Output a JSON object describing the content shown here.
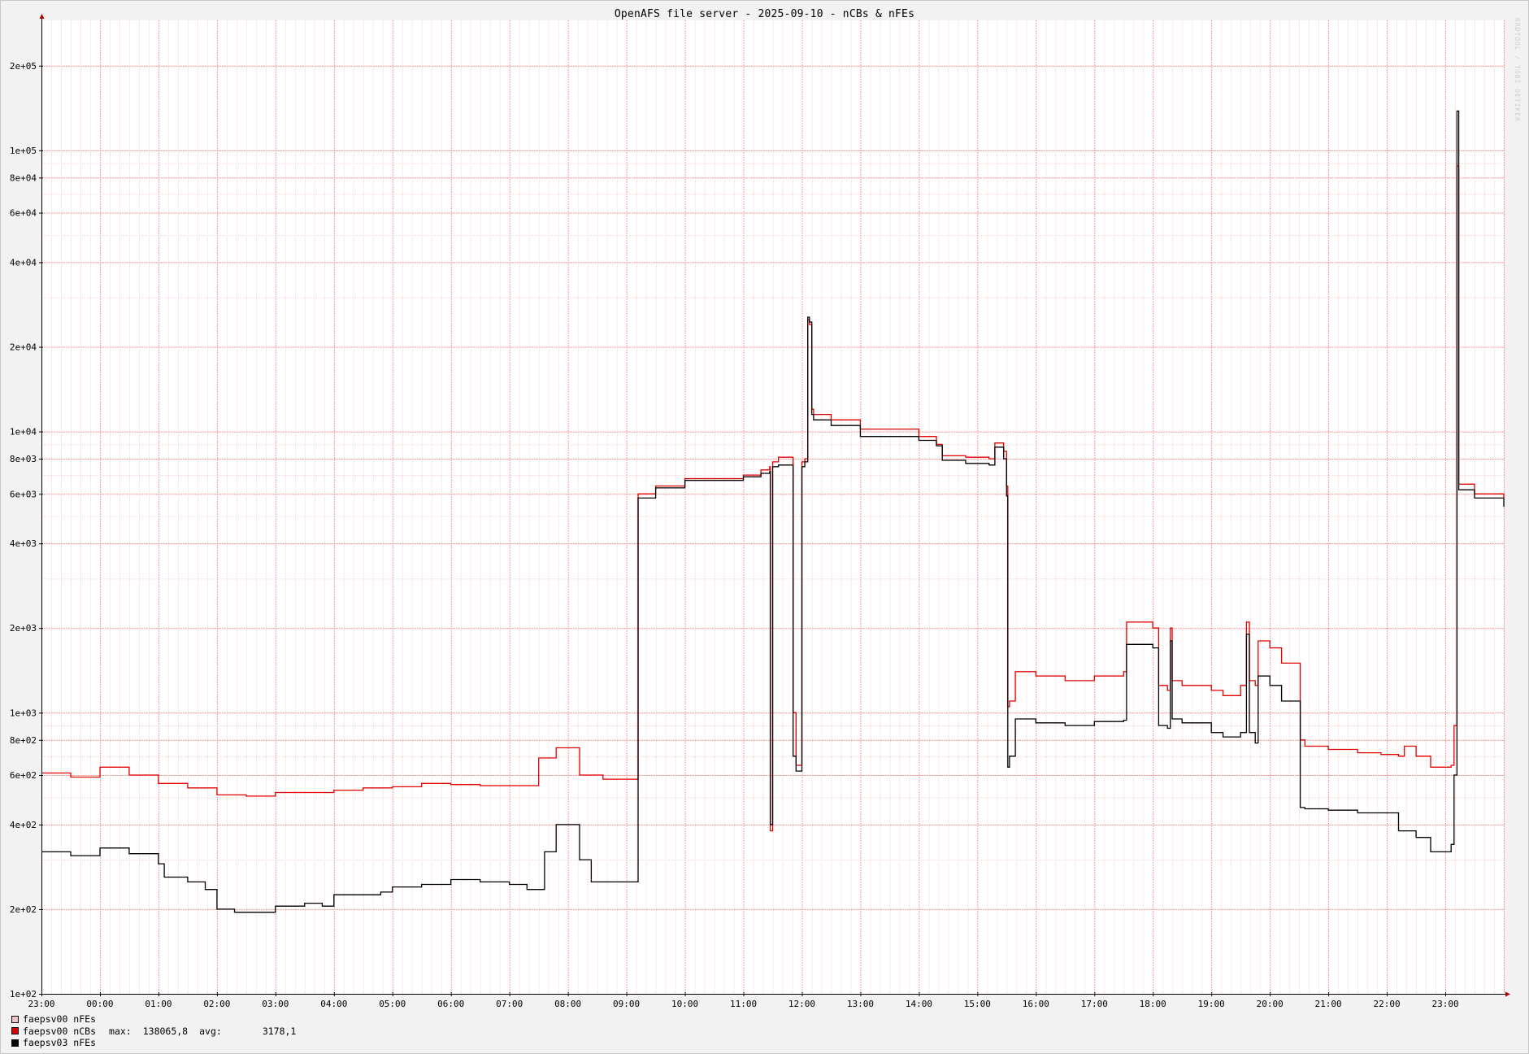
{
  "chart_data": {
    "type": "line",
    "title": "OpenAFS file server - 2025-09-10 - nCBs & nFEs",
    "watermark": "RRDTOOL / TOBI OETIKER",
    "y_scale": "log",
    "ylim": [
      100,
      290000
    ],
    "y_ticks": [
      {
        "value": 200000,
        "label": "2e+05"
      },
      {
        "value": 100000,
        "label": "1e+05"
      },
      {
        "value": 80000,
        "label": "8e+04"
      },
      {
        "value": 60000,
        "label": "6e+04"
      },
      {
        "value": 40000,
        "label": "4e+04"
      },
      {
        "value": 20000,
        "label": "2e+04"
      },
      {
        "value": 10000,
        "label": "1e+04"
      },
      {
        "value": 8000,
        "label": "8e+03"
      },
      {
        "value": 6000,
        "label": "6e+03"
      },
      {
        "value": 4000,
        "label": "4e+03"
      },
      {
        "value": 2000,
        "label": "2e+03"
      },
      {
        "value": 1000,
        "label": "1e+03"
      },
      {
        "value": 800,
        "label": "8e+02"
      },
      {
        "value": 600,
        "label": "6e+02"
      },
      {
        "value": 400,
        "label": "4e+02"
      },
      {
        "value": 200,
        "label": "2e+02"
      },
      {
        "value": 100,
        "label": "1e+02"
      }
    ],
    "x_unit": "hours since 23:00 (previous day)",
    "xlim": [
      0,
      25
    ],
    "x_ticks": [
      "23:00",
      "00:00",
      "01:00",
      "02:00",
      "03:00",
      "04:00",
      "05:00",
      "06:00",
      "07:00",
      "08:00",
      "09:00",
      "10:00",
      "11:00",
      "12:00",
      "13:00",
      "14:00",
      "15:00",
      "16:00",
      "17:00",
      "18:00",
      "19:00",
      "20:00",
      "21:00",
      "22:00",
      "23:00"
    ],
    "grid": true,
    "legend_position": "bottom-left",
    "series": [
      {
        "name": "faepsv00 nFEs",
        "color": "#f2c4c4",
        "values": []
      },
      {
        "name": "faepsv00 nCBs",
        "color": "#e00000",
        "stats": {
          "max_label": "max:",
          "max": "138065,8",
          "avg_label": "avg:",
          "avg": "3178,1"
        },
        "points": [
          [
            0.0,
            610
          ],
          [
            0.5,
            590
          ],
          [
            1.0,
            640
          ],
          [
            1.5,
            600
          ],
          [
            2.0,
            560
          ],
          [
            2.5,
            540
          ],
          [
            3.0,
            510
          ],
          [
            3.5,
            505
          ],
          [
            4.0,
            520
          ],
          [
            4.5,
            520
          ],
          [
            5.0,
            530
          ],
          [
            5.5,
            540
          ],
          [
            6.0,
            545
          ],
          [
            6.5,
            560
          ],
          [
            7.0,
            555
          ],
          [
            7.5,
            550
          ],
          [
            8.0,
            550
          ],
          [
            8.5,
            690
          ],
          [
            8.8,
            750
          ],
          [
            9.2,
            600
          ],
          [
            9.6,
            580
          ],
          [
            10.2,
            6000
          ],
          [
            10.5,
            6400
          ],
          [
            11.0,
            6800
          ],
          [
            12.0,
            7000
          ],
          [
            12.3,
            7300
          ],
          [
            12.45,
            7500
          ],
          [
            12.46,
            380
          ],
          [
            12.5,
            7800
          ],
          [
            12.6,
            8100
          ],
          [
            12.8,
            8100
          ],
          [
            12.85,
            1000
          ],
          [
            12.9,
            650
          ],
          [
            13.0,
            7800
          ],
          [
            13.05,
            8000
          ],
          [
            13.1,
            25000
          ],
          [
            13.13,
            24000
          ],
          [
            13.17,
            12000
          ],
          [
            13.2,
            11500
          ],
          [
            13.5,
            11000
          ],
          [
            14.0,
            10200
          ],
          [
            15.0,
            9600
          ],
          [
            15.3,
            9000
          ],
          [
            15.4,
            8200
          ],
          [
            15.8,
            8100
          ],
          [
            16.2,
            8000
          ],
          [
            16.3,
            9100
          ],
          [
            16.45,
            8500
          ],
          [
            16.5,
            6400
          ],
          [
            16.52,
            1050
          ],
          [
            16.55,
            1100
          ],
          [
            16.65,
            1400
          ],
          [
            17.0,
            1350
          ],
          [
            17.5,
            1300
          ],
          [
            18.0,
            1350
          ],
          [
            18.5,
            1400
          ],
          [
            18.55,
            2100
          ],
          [
            19.0,
            2000
          ],
          [
            19.1,
            1250
          ],
          [
            19.25,
            1200
          ],
          [
            19.3,
            2000
          ],
          [
            19.33,
            1300
          ],
          [
            19.5,
            1250
          ],
          [
            20.0,
            1200
          ],
          [
            20.2,
            1150
          ],
          [
            20.5,
            1250
          ],
          [
            20.6,
            2100
          ],
          [
            20.65,
            1300
          ],
          [
            20.75,
            1250
          ],
          [
            20.8,
            1800
          ],
          [
            21.0,
            1700
          ],
          [
            21.2,
            1500
          ],
          [
            21.52,
            800
          ],
          [
            21.6,
            760
          ],
          [
            22.0,
            740
          ],
          [
            22.5,
            720
          ],
          [
            22.9,
            710
          ],
          [
            23.2,
            700
          ],
          [
            23.3,
            760
          ],
          [
            23.5,
            700
          ],
          [
            23.75,
            640
          ],
          [
            24.1,
            650
          ],
          [
            24.15,
            900
          ],
          [
            24.2,
            88000
          ],
          [
            24.23,
            6500
          ],
          [
            24.5,
            6000
          ],
          [
            25.0,
            5800
          ]
        ]
      },
      {
        "name": "faepsv03 nFEs",
        "color": "#000000",
        "points": [
          [
            0.0,
            320
          ],
          [
            0.5,
            310
          ],
          [
            1.0,
            330
          ],
          [
            1.5,
            315
          ],
          [
            2.0,
            290
          ],
          [
            2.1,
            260
          ],
          [
            2.5,
            250
          ],
          [
            2.8,
            235
          ],
          [
            3.0,
            200
          ],
          [
            3.3,
            195
          ],
          [
            3.6,
            195
          ],
          [
            4.0,
            205
          ],
          [
            4.5,
            210
          ],
          [
            4.8,
            205
          ],
          [
            5.0,
            225
          ],
          [
            5.5,
            225
          ],
          [
            5.8,
            230
          ],
          [
            6.0,
            240
          ],
          [
            6.5,
            245
          ],
          [
            7.0,
            255
          ],
          [
            7.5,
            250
          ],
          [
            8.0,
            245
          ],
          [
            8.3,
            235
          ],
          [
            8.6,
            320
          ],
          [
            8.8,
            400
          ],
          [
            9.2,
            300
          ],
          [
            9.4,
            250
          ],
          [
            9.6,
            250
          ],
          [
            10.2,
            5800
          ],
          [
            10.5,
            6300
          ],
          [
            11.0,
            6700
          ],
          [
            12.0,
            6900
          ],
          [
            12.3,
            7100
          ],
          [
            12.45,
            7200
          ],
          [
            12.46,
            400
          ],
          [
            12.5,
            7500
          ],
          [
            12.6,
            7600
          ],
          [
            12.8,
            7600
          ],
          [
            12.85,
            700
          ],
          [
            12.9,
            620
          ],
          [
            13.0,
            7500
          ],
          [
            13.05,
            7800
          ],
          [
            13.1,
            25500
          ],
          [
            13.13,
            24500
          ],
          [
            13.17,
            11500
          ],
          [
            13.2,
            11000
          ],
          [
            13.5,
            10500
          ],
          [
            14.0,
            9600
          ],
          [
            15.0,
            9300
          ],
          [
            15.3,
            8900
          ],
          [
            15.4,
            7900
          ],
          [
            15.8,
            7700
          ],
          [
            16.2,
            7600
          ],
          [
            16.3,
            8800
          ],
          [
            16.45,
            8000
          ],
          [
            16.5,
            5900
          ],
          [
            16.52,
            640
          ],
          [
            16.55,
            700
          ],
          [
            16.65,
            950
          ],
          [
            17.0,
            920
          ],
          [
            17.5,
            900
          ],
          [
            18.0,
            930
          ],
          [
            18.5,
            940
          ],
          [
            18.55,
            1750
          ],
          [
            19.0,
            1700
          ],
          [
            19.1,
            900
          ],
          [
            19.25,
            880
          ],
          [
            19.3,
            1800
          ],
          [
            19.33,
            950
          ],
          [
            19.5,
            920
          ],
          [
            20.0,
            850
          ],
          [
            20.2,
            820
          ],
          [
            20.5,
            850
          ],
          [
            20.6,
            1900
          ],
          [
            20.65,
            850
          ],
          [
            20.75,
            780
          ],
          [
            20.8,
            1350
          ],
          [
            21.0,
            1250
          ],
          [
            21.2,
            1100
          ],
          [
            21.52,
            460
          ],
          [
            21.6,
            455
          ],
          [
            22.0,
            450
          ],
          [
            22.5,
            440
          ],
          [
            22.9,
            440
          ],
          [
            23.2,
            380
          ],
          [
            23.5,
            360
          ],
          [
            23.75,
            320
          ],
          [
            24.1,
            340
          ],
          [
            24.15,
            600
          ],
          [
            24.2,
            138000
          ],
          [
            24.23,
            6200
          ],
          [
            24.5,
            5800
          ],
          [
            25.0,
            5400
          ]
        ]
      }
    ]
  }
}
